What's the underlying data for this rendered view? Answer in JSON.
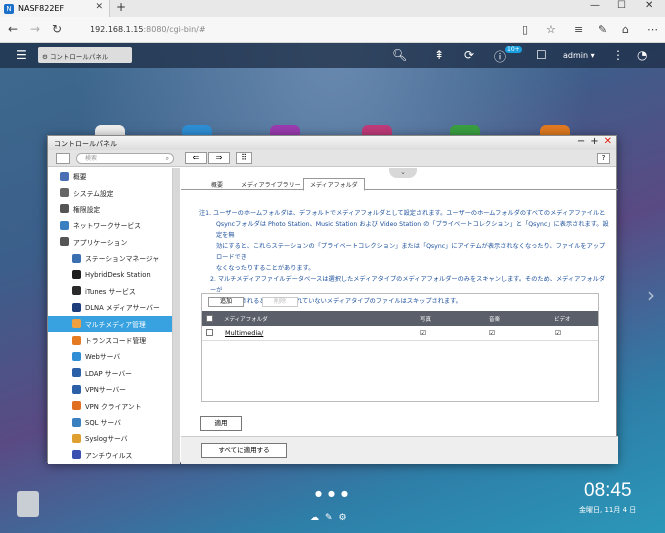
{
  "browser": {
    "tab_title": "NASF822EF",
    "url_host": "192.168.1.15",
    "url_rest": ":8080/cgi-bin/#"
  },
  "qts": {
    "notification_count": "10+",
    "user": "admin ▾"
  },
  "window": {
    "title": "コントロールパネル",
    "search_placeholder": "検索"
  },
  "sidebar": {
    "items": [
      {
        "label": "概要",
        "color": "#4a6fb5"
      },
      {
        "label": "システム設定",
        "color": "#666"
      },
      {
        "label": "権限設定",
        "color": "#555"
      },
      {
        "label": "ネットワークサービス",
        "color": "#3a80c0"
      },
      {
        "label": "アプリケーション",
        "color": "#555"
      },
      {
        "label": "ステーションマネージャ",
        "color": "#3a6fb0"
      },
      {
        "label": "HybridDesk Station",
        "color": "#1d1d1d"
      },
      {
        "label": "iTunes サービス",
        "color": "#2a2a2a"
      },
      {
        "label": "DLNA メディアサーバー",
        "color": "#1d3d7a"
      },
      {
        "label": "マルチメディア管理",
        "color": "#f0a040"
      },
      {
        "label": "トランスコード管理",
        "color": "#e57a20"
      },
      {
        "label": "Webサーバ",
        "color": "#2e8fd6"
      },
      {
        "label": "LDAP サーバー",
        "color": "#2b5fa8"
      },
      {
        "label": "VPNサーバー",
        "color": "#2b5fa8"
      },
      {
        "label": "VPN クライアント",
        "color": "#e07020"
      },
      {
        "label": "SQL サーバ",
        "color": "#3a80c0"
      },
      {
        "label": "Syslogサーバ",
        "color": "#e0a030"
      },
      {
        "label": "アンチウイルス",
        "color": "#3a50b0"
      }
    ]
  },
  "tabs": [
    "概要",
    "メディアライブラリー",
    "メディアフォルダ"
  ],
  "note": {
    "line1": "注1. ユーザーのホームフォルダは、デフォルトでメディアフォルダとして設定されます。ユーザーのホームフォルダのすべてのメディアファイルと",
    "line2": "Qsyncフォルダは Photo Station、Music Station および Video Station の「プライベートコレクション」と「Qsync」に表示されます。設定を無",
    "line3": "効にすると、これらステーションの「プライベートコレクション」または「Qsync」にアイテムが表示されなくなったり、ファイルをアップロードでき",
    "line4": "なくなったりすることがあります。",
    "line5": "2. マルチメディアファイルデータベースは選択したメディアタイプのメディアフォルダーのみをスキャンします。そのため、メディアフォルダーが",
    "line6": "スキャンされるとき、指定されていないメディアタイプのファイルはスキップされます。"
  },
  "panel": {
    "add": "追加",
    "delete": "削除",
    "columns": [
      "メディアフォルダ",
      "写真",
      "音楽",
      "ビデオ"
    ],
    "rows": [
      {
        "folder": "Multimedia/",
        "photo": "☑",
        "music": "☑",
        "video": "☑"
      }
    ]
  },
  "buttons": {
    "apply": "適用",
    "apply_all": "すべてに適用する"
  },
  "clock": {
    "time": "08:45",
    "date": "金曜日, 11月 4 日"
  }
}
